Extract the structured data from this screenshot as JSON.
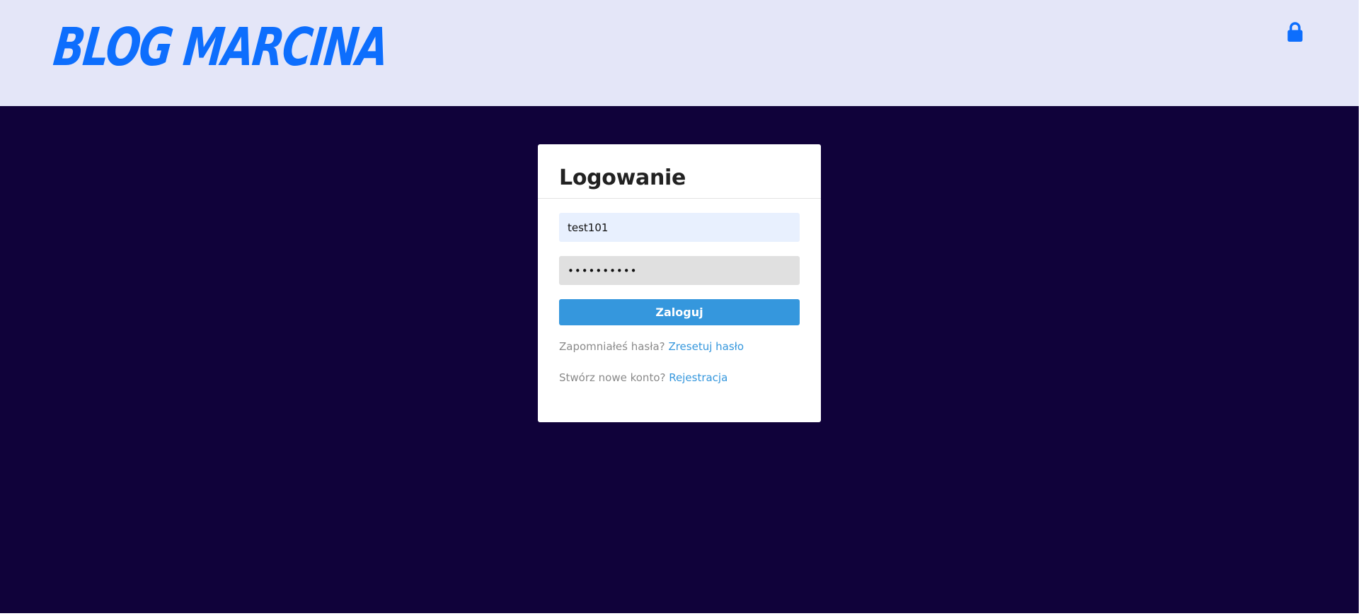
{
  "header": {
    "logo_text": "Blog Marcina",
    "lock_icon": "lock-icon",
    "background_color": "#e4e6f8",
    "logo_color": "#0d6efd"
  },
  "page": {
    "background_color": "#10023a"
  },
  "login_card": {
    "title": "Logowanie",
    "username_value": "test101",
    "password_value": "••••••••••",
    "submit_label": "Zaloguj",
    "forgot_text": "Zapomniałeś hasła?",
    "forgot_link": "Zresetuj hasło",
    "register_text": "Stwórz nowe konto?",
    "register_link": "Rejestracja",
    "accent_color": "#3597dd"
  }
}
